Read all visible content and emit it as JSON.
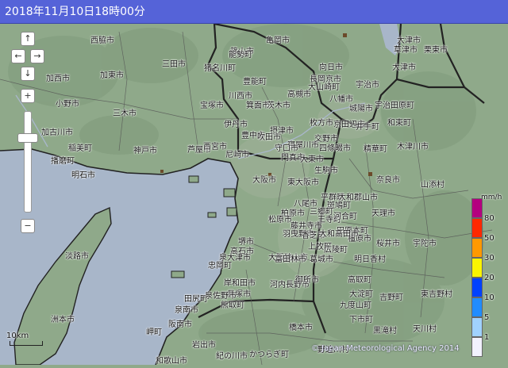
{
  "header": {
    "datetime": "2018年11月10日18時00分"
  },
  "map": {
    "land_color": "#8fa98a",
    "sea_color": "#a8b6c9",
    "cities": [
      {
        "id": "nishiwaki",
        "label": "西脇市"
      },
      {
        "id": "sasayama",
        "label": "篠山市"
      },
      {
        "id": "kameoka",
        "label": "亀岡市"
      },
      {
        "id": "otsu-kita",
        "label": "大津市"
      },
      {
        "id": "kato",
        "label": "加西市"
      },
      {
        "id": "kasai",
        "label": "加東市"
      },
      {
        "id": "sanda",
        "label": "三田市"
      },
      {
        "id": "inagawa",
        "label": "猪名川町"
      },
      {
        "id": "nose",
        "label": "能勢町"
      },
      {
        "id": "mukou",
        "label": "向日市"
      },
      {
        "id": "kyoto-nagaoka",
        "label": "長岡京市"
      },
      {
        "id": "uji",
        "label": "宇治市"
      },
      {
        "id": "kusatsu",
        "label": "草津市"
      },
      {
        "id": "ritto",
        "label": "栗東市"
      },
      {
        "id": "otsu",
        "label": "大津市"
      },
      {
        "id": "ono",
        "label": "小野市"
      },
      {
        "id": "miki",
        "label": "三木市"
      },
      {
        "id": "takarazuka",
        "label": "宝塚市"
      },
      {
        "id": "kawanishi",
        "label": "川西市"
      },
      {
        "id": "minoh",
        "label": "箕面市"
      },
      {
        "id": "ibaraki",
        "label": "茨木市"
      },
      {
        "id": "takatsuki",
        "label": "高槻市"
      },
      {
        "id": "toyono",
        "label": "豊能町"
      },
      {
        "id": "oyamazaki",
        "label": "大山崎町"
      },
      {
        "id": "yawata",
        "label": "八幡市"
      },
      {
        "id": "joyo",
        "label": "城陽市"
      },
      {
        "id": "ujitawara",
        "label": "宇治田原町"
      },
      {
        "id": "wazuka",
        "label": "和束町"
      },
      {
        "id": "kyotanabe",
        "label": "京田辺市"
      },
      {
        "id": "ide",
        "label": "井手町"
      },
      {
        "id": "kakogawa",
        "label": "加古川市"
      },
      {
        "id": "inami",
        "label": "稲美町"
      },
      {
        "id": "kobe",
        "label": "神戸市"
      },
      {
        "id": "ashiya",
        "label": "芦屋市"
      },
      {
        "id": "nishinomiya",
        "label": "西宮市"
      },
      {
        "id": "itami",
        "label": "伊丹市"
      },
      {
        "id": "toyonaka",
        "label": "豊中市"
      },
      {
        "id": "suita",
        "label": "吹田市"
      },
      {
        "id": "settsu",
        "label": "摂津市"
      },
      {
        "id": "neyagawa",
        "label": "寝屋川市"
      },
      {
        "id": "hirakata",
        "label": "枚方市"
      },
      {
        "id": "katano",
        "label": "交野市"
      },
      {
        "id": "shijonawate",
        "label": "四條畷市"
      },
      {
        "id": "seika",
        "label": "精華町"
      },
      {
        "id": "kizugawa",
        "label": "木津川市"
      },
      {
        "id": "harima",
        "label": "播磨町"
      },
      {
        "id": "akashi",
        "label": "明石市"
      },
      {
        "id": "amagasaki",
        "label": "尼崎市"
      },
      {
        "id": "osaka",
        "label": "大阪市"
      },
      {
        "id": "moriguchi",
        "label": "守口市"
      },
      {
        "id": "kadoma",
        "label": "門真市"
      },
      {
        "id": "daito",
        "label": "大東市"
      },
      {
        "id": "higashiosaka",
        "label": "東大阪市"
      },
      {
        "id": "ikoma",
        "label": "生駒市"
      },
      {
        "id": "nara",
        "label": "奈良市"
      },
      {
        "id": "yamazoe",
        "label": "山添村"
      },
      {
        "id": "heguri",
        "label": "平群町"
      },
      {
        "id": "yamatokoriyama",
        "label": "大和郡山市"
      },
      {
        "id": "ikaruga",
        "label": "斑鳩町"
      },
      {
        "id": "tenri",
        "label": "天理市"
      },
      {
        "id": "yao",
        "label": "八尾市"
      },
      {
        "id": "sango",
        "label": "三郷町"
      },
      {
        "id": "oji",
        "label": "王寺町"
      },
      {
        "id": "kashiwara",
        "label": "柏原市"
      },
      {
        "id": "matsubara",
        "label": "松原市"
      },
      {
        "id": "fujiidera",
        "label": "藤井寺市"
      },
      {
        "id": "habikino",
        "label": "羽曳野市"
      },
      {
        "id": "kashiba",
        "label": "香芝市"
      },
      {
        "id": "kawai",
        "label": "河合町"
      },
      {
        "id": "tawaramoto",
        "label": "田原本町"
      },
      {
        "id": "sakai",
        "label": "堺市"
      },
      {
        "id": "takaishi",
        "label": "高石市"
      },
      {
        "id": "osakasayama",
        "label": "大阪狭山市"
      },
      {
        "id": "kanmaki",
        "label": "上牧町"
      },
      {
        "id": "koryo",
        "label": "広陵町"
      },
      {
        "id": "kashihara",
        "label": "橿原市"
      },
      {
        "id": "sakurai",
        "label": "桜井市"
      },
      {
        "id": "uda",
        "label": "宇陀市"
      },
      {
        "id": "awaji",
        "label": "淡路市"
      },
      {
        "id": "izumiotsu",
        "label": "泉大津市"
      },
      {
        "id": "tadaoka",
        "label": "忠岡町"
      },
      {
        "id": "tondabayashi",
        "label": "富田林市"
      },
      {
        "id": "katsuragi",
        "label": "葛城市"
      },
      {
        "id": "kishiwada",
        "label": "岸和田市"
      },
      {
        "id": "kawachinagano",
        "label": "河内長野市"
      },
      {
        "id": "asuka",
        "label": "明日香村"
      },
      {
        "id": "kaizuka",
        "label": "貝塚市"
      },
      {
        "id": "gose",
        "label": "御所市"
      },
      {
        "id": "takatori",
        "label": "高取町"
      },
      {
        "id": "oyodo",
        "label": "大淀町"
      },
      {
        "id": "yoshino",
        "label": "吉野町"
      },
      {
        "id": "higashiyoshino",
        "label": "東吉野村"
      },
      {
        "id": "tajiri",
        "label": "田尻町"
      },
      {
        "id": "izumisano",
        "label": "泉佐野市"
      },
      {
        "id": "kumatori",
        "label": "熊取町"
      },
      {
        "id": "kudoyama",
        "label": "九度山町"
      },
      {
        "id": "shimoichi",
        "label": "下市町"
      },
      {
        "id": "kurotaki",
        "label": "黒滝村"
      },
      {
        "id": "sumoto",
        "label": "洲本市"
      },
      {
        "id": "sennan",
        "label": "泉南市"
      },
      {
        "id": "hannan",
        "label": "阪南市"
      },
      {
        "id": "hashimoto",
        "label": "橋本市"
      },
      {
        "id": "katsuragi2",
        "label": "かつらぎ町"
      },
      {
        "id": "kinokawa",
        "label": "紀の川市"
      },
      {
        "id": "iwade",
        "label": "岩出市"
      },
      {
        "id": "misaki",
        "label": "岬町"
      },
      {
        "id": "wakayama",
        "label": "和歌山市"
      },
      {
        "id": "nosegawa",
        "label": "野迫川村"
      },
      {
        "id": "tenkawa",
        "label": "天川村"
      },
      {
        "id": "yamatotakada",
        "label": "大和高田市"
      },
      {
        "id": "yamatoshitaba",
        "label": "大和高田市"
      },
      {
        "id": "kamitsuki",
        "label": "川上村"
      },
      {
        "id": "kyoto-kameoka",
        "label": "京田辺市"
      },
      {
        "id": "yamazoe2",
        "label": "山添村"
      },
      {
        "id": "nabari",
        "label": "名張市"
      }
    ]
  },
  "legend": {
    "unit": "mm/h",
    "levels": [
      {
        "label": "80",
        "color": "#b4007f"
      },
      {
        "label": "50",
        "color": "#ff2800"
      },
      {
        "label": "30",
        "color": "#ff9900"
      },
      {
        "label": "20",
        "color": "#faf500"
      },
      {
        "label": "10",
        "color": "#0041ff"
      },
      {
        "label": "5",
        "color": "#218cff"
      },
      {
        "label": "1",
        "color": "#a0d2ff"
      },
      {
        "label": "",
        "color": "#f2f2ff"
      }
    ]
  },
  "scale": {
    "label": "10km"
  },
  "credit": {
    "text": "© Japan Meteorological Agency 2014"
  },
  "controls": {
    "pan_up": "↑",
    "pan_left": "←",
    "pan_right": "→",
    "pan_down": "↓",
    "zoom_in": "+",
    "zoom_out": "−"
  }
}
